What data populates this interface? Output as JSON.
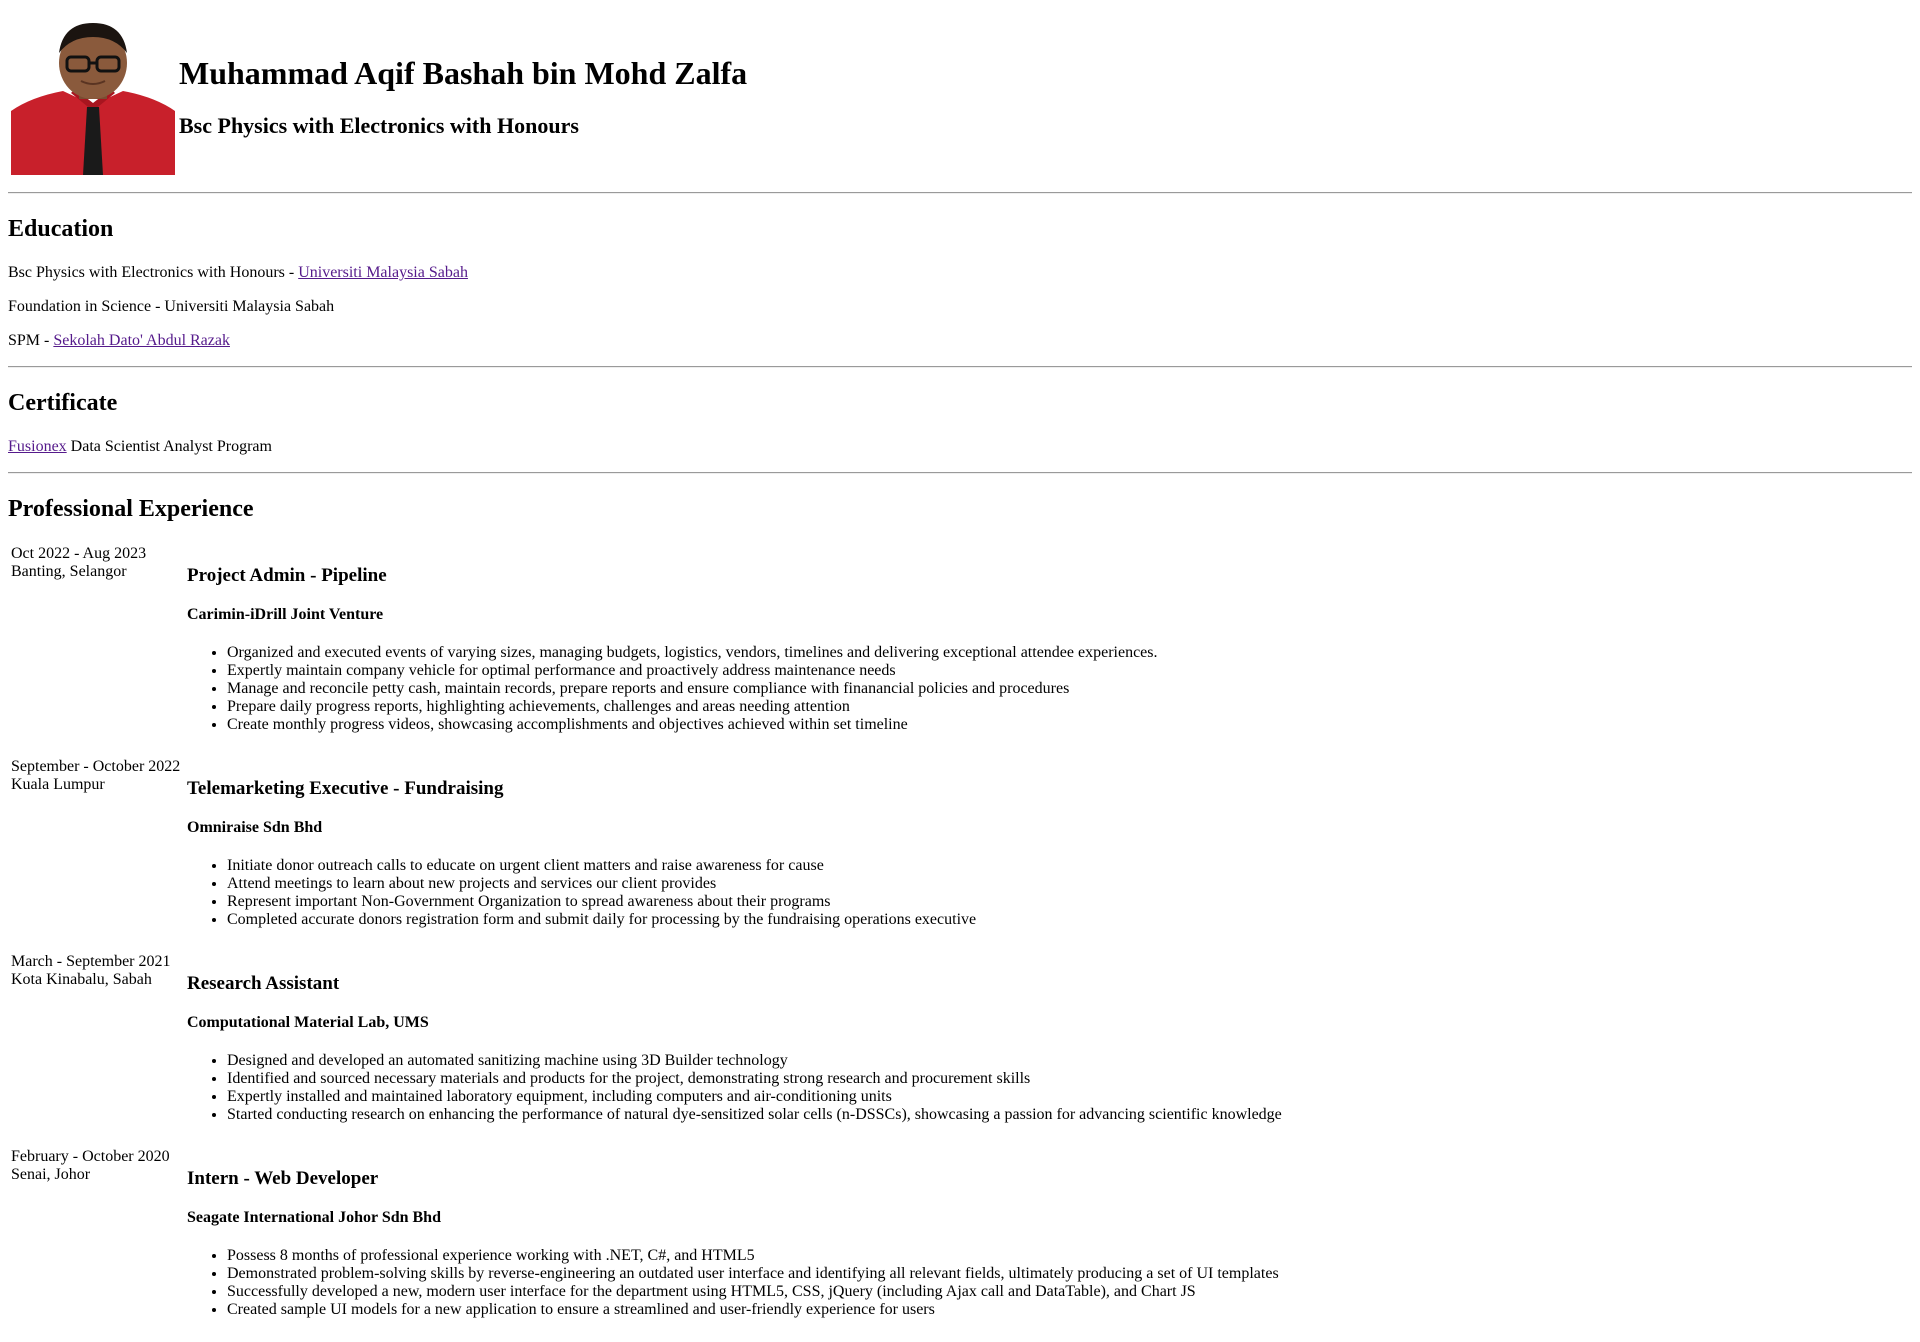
{
  "header": {
    "name": "Muhammad Aqif Bashah bin Mohd Zalfa",
    "degree": "Bsc Physics with Electronics with Honours",
    "colors": {
      "shirt": "#c8202b",
      "background": "#ffffff",
      "tie": "#1a1a1a",
      "skin": "#8a5a3c"
    }
  },
  "education": {
    "heading": "Education",
    "items": [
      {
        "text": "Bsc Physics with Electronics with Honours - ",
        "link": "Universiti Malaysia Sabah"
      },
      {
        "text": "Foundation in Science - Universiti Malaysia Sabah",
        "link": ""
      },
      {
        "text": "SPM - ",
        "link": "Sekolah Dato' Abdul Razak"
      }
    ]
  },
  "certificate": {
    "heading": "Certificate",
    "link": "Fusionex",
    "text": " Data Scientist Analyst Program"
  },
  "experience": {
    "heading": "Professional Experience",
    "jobs": [
      {
        "dates": "Oct 2022 - Aug 2023",
        "location": "Banting, Selangor",
        "title": "Project Admin - Pipeline",
        "company": "Carimin-iDrill Joint Venture",
        "duties": [
          "Organized and executed events of varying sizes, managing budgets, logistics, vendors, timelines and delivering exceptional attendee experiences.",
          "Expertly maintain company vehicle for optimal performance and proactively address maintenance needs",
          "Manage and reconcile petty cash, maintain records, prepare reports and ensure compliance with finanancial policies and procedures",
          "Prepare daily progress reports, highlighting achievements, challenges and areas needing attention",
          "Create monthly progress videos, showcasing accomplishments and objectives achieved within set timeline"
        ]
      },
      {
        "dates": "September - October 2022",
        "location": "Kuala Lumpur",
        "title": "Telemarketing Executive - Fundraising",
        "company": "Omniraise Sdn Bhd",
        "duties": [
          "Initiate donor outreach calls to educate on urgent client matters and raise awareness for cause",
          "Attend meetings to learn about new projects and services our client provides",
          "Represent important Non-Government Organization to spread awareness about their programs",
          "Completed accurate donors registration form and submit daily for processing by the fundraising operations executive"
        ]
      },
      {
        "dates": "March - September 2021",
        "location": "Kota Kinabalu, Sabah",
        "title": "Research Assistant",
        "company": "Computational Material Lab, UMS",
        "duties": [
          "Designed and developed an automated sanitizing machine using 3D Builder technology",
          "Identified and sourced necessary materials and products for the project, demonstrating strong research and procurement skills",
          "Expertly installed and maintained laboratory equipment, including computers and air-conditioning units",
          "Started conducting research on enhancing the performance of natural dye-sensitized solar cells (n-DSSCs), showcasing a passion for advancing scientific knowledge"
        ]
      },
      {
        "dates": "February - October 2020",
        "location": "Senai, Johor",
        "title": "Intern - Web Developer",
        "company": "Seagate International Johor Sdn Bhd",
        "duties": [
          "Possess 8 months of professional experience working with .NET, C#, and HTML5",
          "Demonstrated problem-solving skills by reverse-engineering an outdated user interface and identifying all relevant fields, ultimately producing a set of UI templates",
          "Successfully developed a new, modern user interface for the department using HTML5, CSS, jQuery (including Ajax call and DataTable), and Chart JS",
          "Created sample UI models for a new application to ensure a streamlined and user-friendly experience for users"
        ]
      }
    ]
  }
}
